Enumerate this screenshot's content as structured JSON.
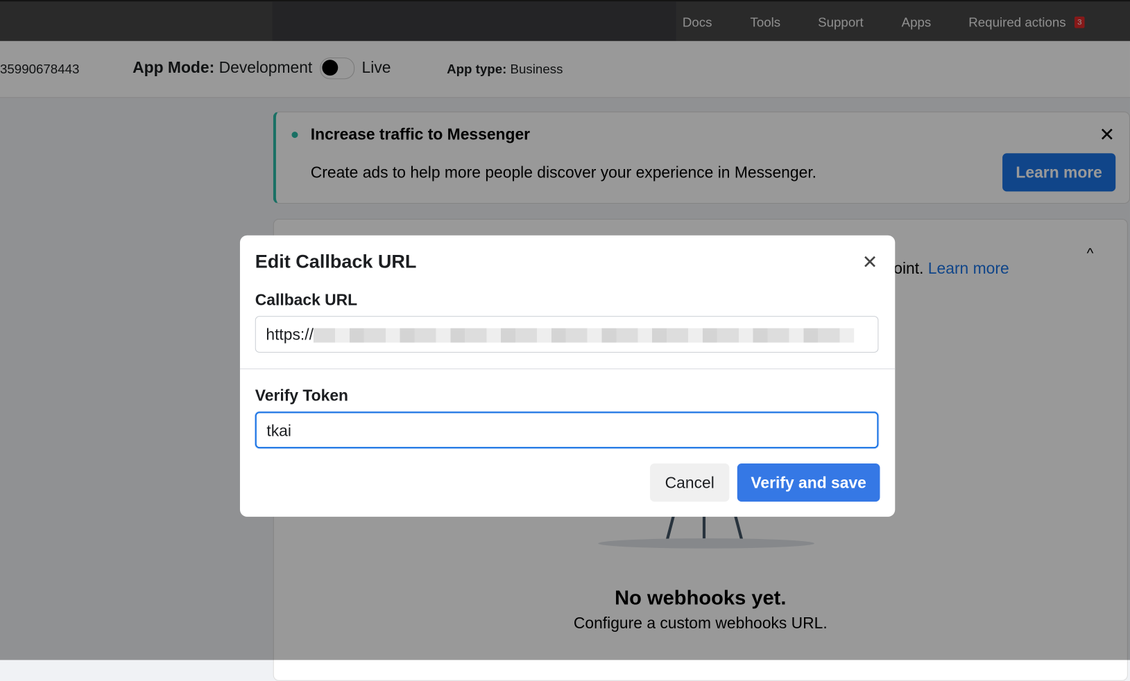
{
  "topbar": {
    "nav": [
      "Docs",
      "Tools",
      "Support",
      "Apps",
      "Required actions"
    ],
    "required_actions_count": "3"
  },
  "subbar": {
    "app_id": "35990678443",
    "app_mode_label": "App Mode:",
    "app_mode_value": "Development",
    "live_label": "Live",
    "app_type_label": "App type:",
    "app_type_value": "Business"
  },
  "banner": {
    "title": "Increase traffic to Messenger",
    "text": "Create ads to help more people discover your experience in Messenger.",
    "button": "Learn more"
  },
  "webhooks": {
    "desc_tail": "oint.",
    "learn_more": "Learn more",
    "empty_title": "No webhooks yet.",
    "empty_text": "Configure a custom webhooks URL."
  },
  "dialog": {
    "title": "Edit Callback URL",
    "callback_label": "Callback URL",
    "callback_value": "https://",
    "token_label": "Verify Token",
    "token_value": "tkai",
    "cancel": "Cancel",
    "save": "Verify and save"
  }
}
